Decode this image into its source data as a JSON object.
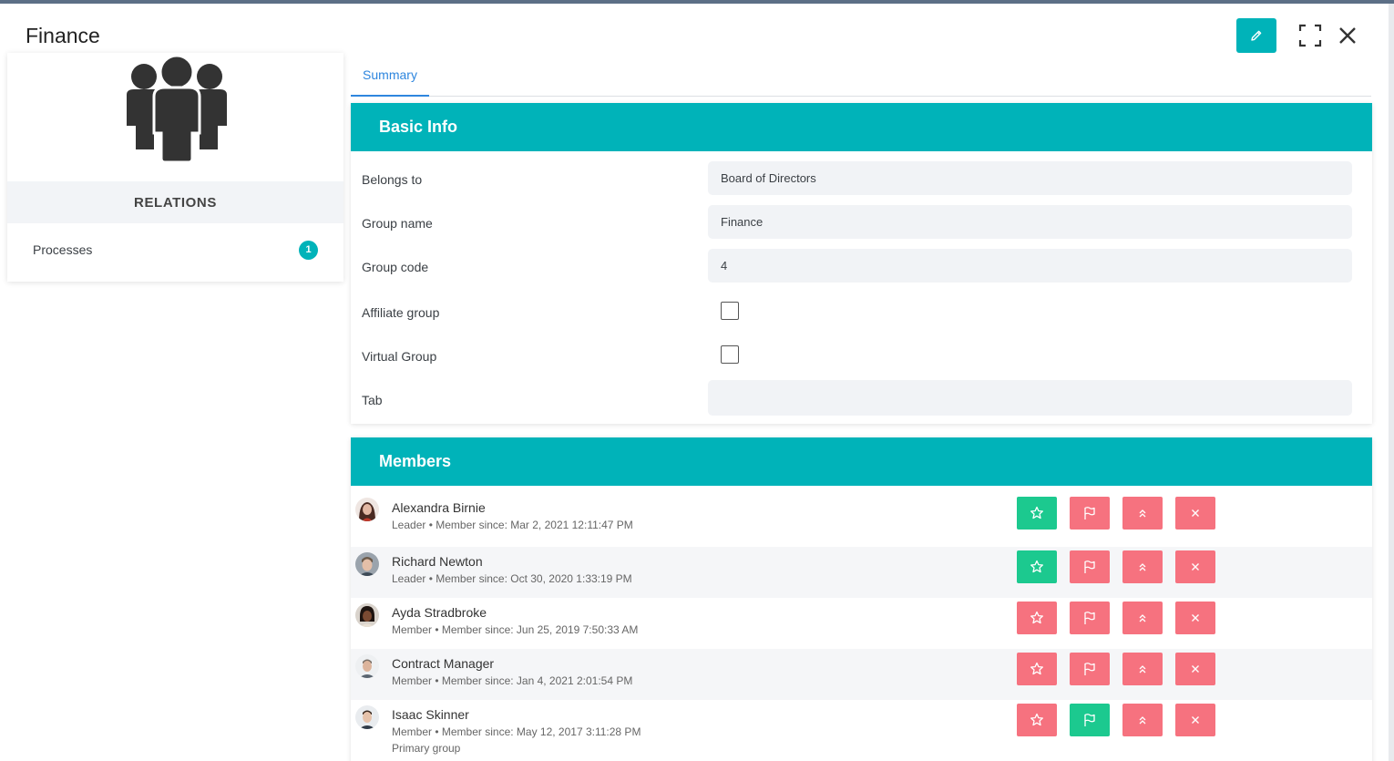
{
  "header": {
    "title": "Finance"
  },
  "left": {
    "relations_title": "RELATIONS",
    "relations": [
      {
        "label": "Processes",
        "count": "1"
      }
    ]
  },
  "tabs": [
    {
      "label": "Summary",
      "active": true
    }
  ],
  "basic_info": {
    "title": "Basic Info",
    "fields": {
      "belongs_to": {
        "label": "Belongs to",
        "value": "Board of Directors"
      },
      "group_name": {
        "label": "Group name",
        "value": "Finance"
      },
      "group_code": {
        "label": "Group code",
        "value": "4"
      },
      "affiliate_group": {
        "label": "Affiliate group",
        "checked": false
      },
      "virtual_group": {
        "label": "Virtual Group",
        "checked": false
      },
      "tab": {
        "label": "Tab",
        "value": ""
      }
    }
  },
  "members": {
    "title": "Members",
    "list": [
      {
        "name": "Alexandra Birnie",
        "meta": "Leader • Member since: Mar 2, 2021 12:11:47 PM",
        "extra": "",
        "star_active": true,
        "flag_active": false
      },
      {
        "name": "Richard Newton",
        "meta": "Leader • Member since: Oct 30, 2020 1:33:19 PM",
        "extra": "",
        "star_active": true,
        "flag_active": false
      },
      {
        "name": "Ayda Stradbroke",
        "meta": "Member • Member since: Jun 25, 2019 7:50:33 AM",
        "extra": "",
        "star_active": false,
        "flag_active": false
      },
      {
        "name": "Contract Manager",
        "meta": "Member • Member since: Jan 4, 2021 2:01:54 PM",
        "extra": "",
        "star_active": false,
        "flag_active": false
      },
      {
        "name": "Isaac Skinner",
        "meta": "Member • Member since: May 12, 2017 3:11:28 PM",
        "extra": "Primary group",
        "star_active": false,
        "flag_active": true
      }
    ]
  },
  "colors": {
    "accent": "#00b3b9",
    "tab_active": "#2e86de",
    "action_pink": "#f6727f",
    "action_green": "#1cc98f"
  }
}
